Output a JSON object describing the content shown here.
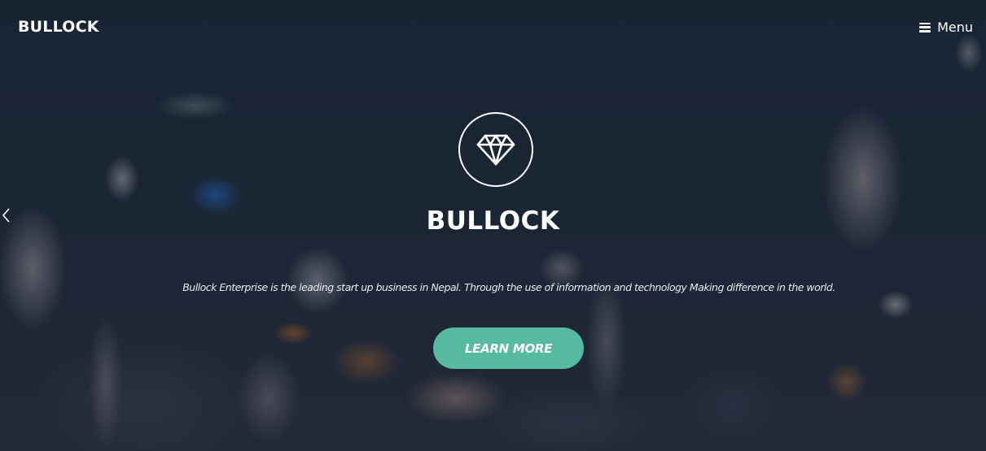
{
  "header": {
    "brand": "BULLOCK",
    "menu_label": "Menu",
    "menu_icon": "hamburger-icon"
  },
  "carousel": {
    "prev_icon": "chevron-left-icon"
  },
  "hero": {
    "logo_icon": "diamond-icon",
    "title": "BULLOCK",
    "description": "Bullock Enterprise is the leading start up business in Nepal. Through the use of information and technology Making difference in the world.",
    "cta_label": "LEARN MORE"
  },
  "colors": {
    "accent": "#56bba0",
    "background": "#1b2636",
    "text": "#ffffff"
  }
}
